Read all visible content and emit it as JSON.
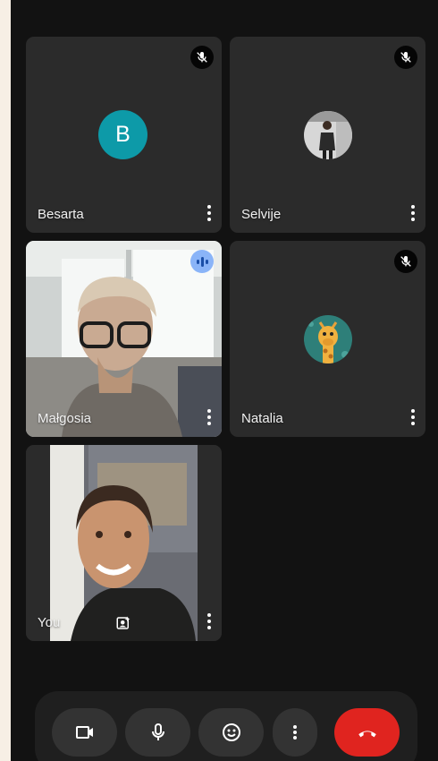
{
  "participants": [
    {
      "name": "Besarta",
      "avatar_letter": "B",
      "muted": true
    },
    {
      "name": "Selvije",
      "muted": true
    },
    {
      "name": "Małgosia",
      "speaking": true
    },
    {
      "name": "Natalia",
      "muted": true
    },
    {
      "name": "You"
    }
  ],
  "controls": {
    "camera": "camera-icon",
    "microphone": "microphone-icon",
    "reactions": "emoji-icon",
    "more": "more-options-icon",
    "end_call": "hang-up-icon"
  },
  "colors": {
    "background": "#121212",
    "tile": "#2b2b2b",
    "avatar_teal": "#0d9aa8",
    "speaking": "#8ab4f8",
    "end_call": "#e0241f"
  }
}
